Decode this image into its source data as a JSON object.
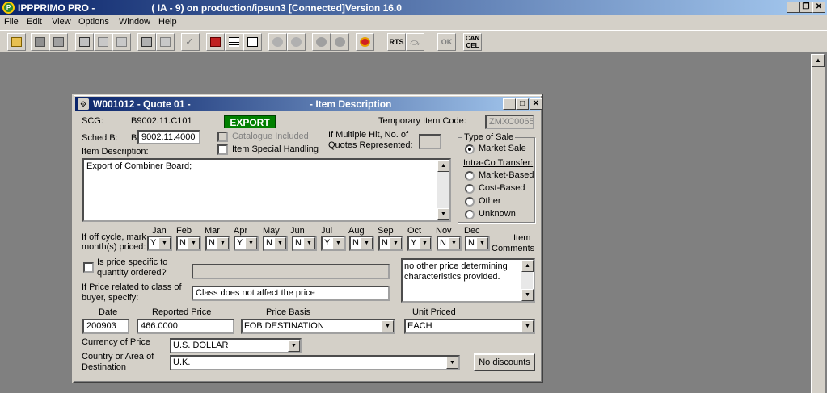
{
  "app": {
    "title": "IPPPRIMO PRO -                     ( IA - 9) on production/ipsun3 [Connected]Version 16.0",
    "icon_letter": "P"
  },
  "menu": [
    "File",
    "Edit",
    "View",
    "Options",
    "Window",
    "Help"
  ],
  "toolbar": {
    "rts_label": "RTS",
    "ok_label": "OK",
    "cancel_label": "CAN\nCEL"
  },
  "dialog": {
    "title_left": "W001012 - Quote 01 -",
    "title_right": "- Item Description",
    "scg_label": "SCG:",
    "scg_value": "B9002.11.C101",
    "export_badge": "EXPORT",
    "temp_code_label": "Temporary Item Code:",
    "temp_code_value": "ZMXC0065",
    "sched_b_label": "Sched B:",
    "sched_b_prefix": "B",
    "sched_b_value": "9002.11.4000",
    "catalogue_label": "Catalogue Included",
    "special_handling_label": "Item Special Handling",
    "multiple_hit_label_1": "If Multiple Hit, No. of",
    "multiple_hit_label_2": "Quotes Represented:",
    "item_desc_label": "Item Description:",
    "item_desc_value": "Export of Combiner Board;",
    "type_of_sale": {
      "title": "Type of Sale",
      "market_sale": "Market Sale",
      "intra_title": "Intra-Co Transfer:",
      "options": [
        "Market-Based",
        "Cost-Based",
        "Other",
        "Unknown"
      ]
    },
    "off_cycle_label_1": "If off cycle, mark",
    "off_cycle_label_2": "month(s) priced:",
    "months": [
      {
        "name": "Jan",
        "value": "Y"
      },
      {
        "name": "Feb",
        "value": "N"
      },
      {
        "name": "Mar",
        "value": "N"
      },
      {
        "name": "Apr",
        "value": "Y"
      },
      {
        "name": "May",
        "value": "N"
      },
      {
        "name": "Jun",
        "value": "N"
      },
      {
        "name": "Jul",
        "value": "Y"
      },
      {
        "name": "Aug",
        "value": "N"
      },
      {
        "name": "Sep",
        "value": "N"
      },
      {
        "name": "Oct",
        "value": "Y"
      },
      {
        "name": "Nov",
        "value": "N"
      },
      {
        "name": "Dec",
        "value": "N"
      }
    ],
    "item_comments_label_1": "Item",
    "item_comments_label_2": "Comments",
    "qty_label_1": "Is price specific to",
    "qty_label_2": "quantity ordered?",
    "comments_value": "no other price determining characteristics provided.",
    "buyer_class_label_1": "If Price related to class of",
    "buyer_class_label_2": "buyer, specify:",
    "buyer_class_value": "Class does not affect the price",
    "date_label": "Date",
    "date_value": "200903",
    "reported_price_label": "Reported Price",
    "reported_price_value": "466.0000",
    "price_basis_label": "Price Basis",
    "price_basis_value": "FOB DESTINATION",
    "unit_priced_label": "Unit Priced",
    "unit_priced_value": "EACH",
    "currency_label": "Currency of Price",
    "currency_value": "U.S. DOLLAR",
    "country_label_1": "Country or Area of",
    "country_label_2": "Destination",
    "country_value": "U.K.",
    "no_discounts_label": "No discounts"
  },
  "colors": {
    "title_blue": "#0a246a",
    "export_green": "#008000",
    "face": "#d4d0c8"
  }
}
